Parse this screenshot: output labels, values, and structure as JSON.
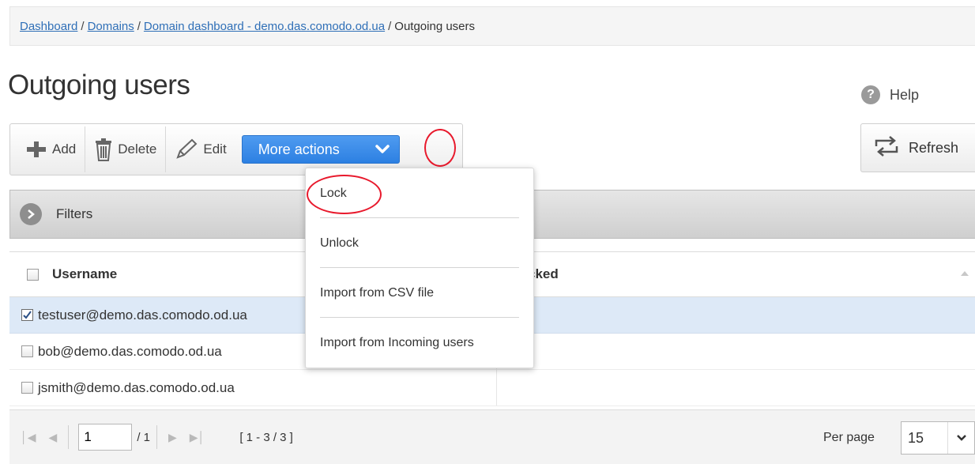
{
  "breadcrumb": {
    "items": [
      {
        "label": "Dashboard"
      },
      {
        "label": "Domains"
      },
      {
        "label": "Domain dashboard - demo.das.comodo.od.ua"
      }
    ],
    "current": "Outgoing users",
    "separator": "/"
  },
  "page": {
    "title": "Outgoing users",
    "help_label": "Help"
  },
  "toolbar": {
    "add_label": "Add",
    "delete_label": "Delete",
    "edit_label": "Edit",
    "more_actions_label": "More actions",
    "refresh_label": "Refresh"
  },
  "more_actions_menu": {
    "items": [
      "Lock",
      "Unlock",
      "Import from CSV file",
      "Import from Incoming users"
    ]
  },
  "filters": {
    "label": "Filters"
  },
  "table": {
    "columns": {
      "username": "Username",
      "locked": "cked"
    },
    "rows": [
      {
        "username": "testuser@demo.das.comodo.od.ua",
        "checked": true,
        "selected": true
      },
      {
        "username": "bob@demo.das.comodo.od.ua",
        "checked": false,
        "selected": false
      },
      {
        "username": "jsmith@demo.das.comodo.od.ua",
        "checked": false,
        "selected": false
      }
    ]
  },
  "pager": {
    "current_page": "1",
    "total_pages": "/ 1",
    "range": "[ 1 - 3 / 3 ]",
    "per_page_label": "Per page",
    "per_page_value": "15"
  },
  "colors": {
    "accent": "#2c80e2",
    "annotation": "#e8192c",
    "link": "#2f6fb7"
  }
}
